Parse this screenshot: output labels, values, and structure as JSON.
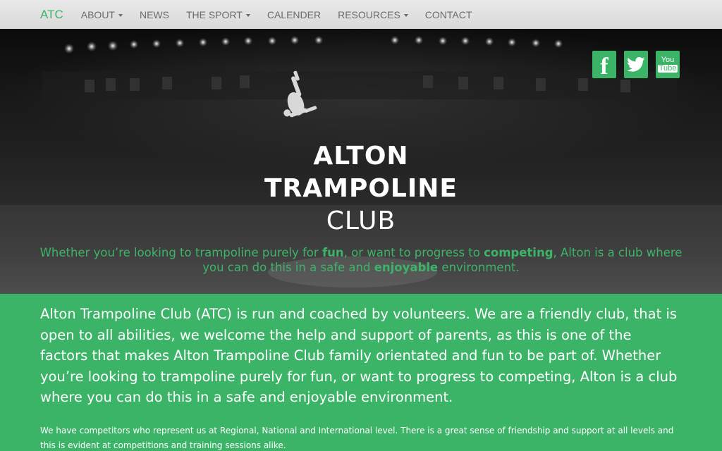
{
  "nav": {
    "brand": "ATC",
    "items": [
      {
        "label": "ABOUT",
        "dropdown": true
      },
      {
        "label": "NEWS",
        "dropdown": false
      },
      {
        "label": "THE SPORT",
        "dropdown": true
      },
      {
        "label": "CALENDER",
        "dropdown": false
      },
      {
        "label": "RESOURCES",
        "dropdown": true
      },
      {
        "label": "CONTACT",
        "dropdown": false
      }
    ]
  },
  "social": {
    "facebook_glyph": "f",
    "youtube_top": "You",
    "youtube_bottom": "Tube",
    "icons": [
      "facebook-icon",
      "twitter-icon",
      "youtube-icon"
    ]
  },
  "hero": {
    "title_line1": "ALTON",
    "title_line2": "TRAMPOLINE",
    "title_line3": "CLUB",
    "tagline": {
      "t1": "Whether you’re looking to trampoline purely for ",
      "b1": "fun",
      "t2": ", or want to progress to ",
      "b2": "competing",
      "t3": ", Alton is a club where you can do this in a safe and ",
      "b3": "enjoyable",
      "t4": " environment."
    }
  },
  "intro": {
    "lead": "Alton Trampoline Club (ATC) is run and coached by volunteers. We are a friendly club, that is open to all abilities, we welcome the help and support of parents, as this is one of the factors that makes Alton Trampoline Club family orientated and fun to be part of. Whether you’re looking to trampoline purely for fun, or want to progress to competing, Alton is a club where you can do this in a safe and enjoyable environment.",
    "sub": "We have competitors who represent us at Regional, National and International level. There is a great sense of friendship and support at all levels and this is evident at competitions and training sessions alike."
  },
  "colors": {
    "accent": "#3cb468",
    "navbar_bg": "#e0e0e0",
    "nav_text": "#6b6b6b"
  }
}
